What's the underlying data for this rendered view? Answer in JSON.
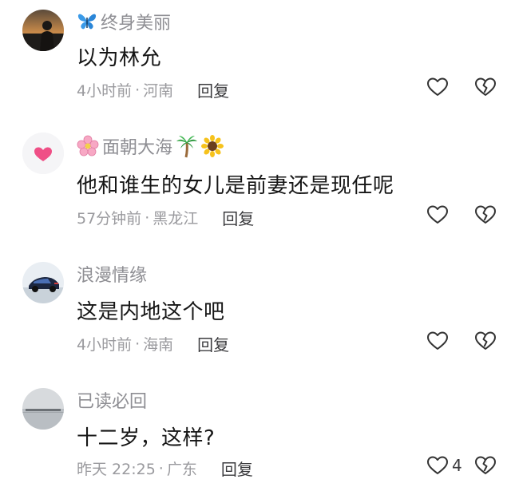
{
  "comments": [
    {
      "username": "终身美丽",
      "username_prefix_icon": "butterfly-icon",
      "username_suffix_icons": [],
      "text": "以为林允",
      "time": "4小时前",
      "separator": "·",
      "location": "河南",
      "reply_label": "回复",
      "like_count": ""
    },
    {
      "username": "面朝大海",
      "username_prefix_icon": "cherry-blossom-icon",
      "username_suffix_icons": [
        "palm-tree-icon",
        "sunflower-icon"
      ],
      "text": "他和谁生的女儿是前妻还是现任呢",
      "time": "57分钟前",
      "separator": "·",
      "location": "黑龙江",
      "reply_label": "回复",
      "like_count": ""
    },
    {
      "username": "浪漫情缘",
      "username_prefix_icon": "",
      "username_suffix_icons": [],
      "text": "这是内地这个吧",
      "time": "4小时前",
      "separator": "·",
      "location": "海南",
      "reply_label": "回复",
      "like_count": ""
    },
    {
      "username": "已读必回",
      "username_prefix_icon": "",
      "username_suffix_icons": [],
      "text": "十二岁，这样?",
      "time": "昨天 22:25",
      "separator": "·",
      "location": "广东",
      "reply_label": "回复",
      "like_count": "4"
    }
  ],
  "colors": {
    "username": "#8e8e93",
    "text": "#161616",
    "meta": "#9a9a9e",
    "reply": "#3b3b3e",
    "icon_stroke": "#333333"
  }
}
